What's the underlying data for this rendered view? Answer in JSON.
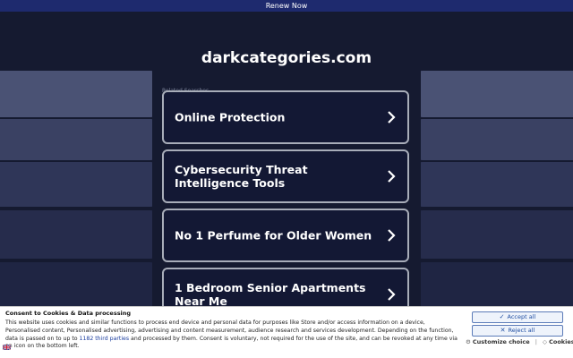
{
  "topbar": {
    "label": "Renew Now"
  },
  "site": {
    "domain": "darkcategories.com"
  },
  "related": {
    "label": "Related Searches"
  },
  "cards": [
    {
      "label": "Online Protection"
    },
    {
      "label": "Cybersecurity Threat Intelligence Tools"
    },
    {
      "label": "No 1 Perfume for Older Women"
    },
    {
      "label": "1 Bedroom Senior Apartments Near Me"
    }
  ],
  "cookie": {
    "title": "Consent to Cookies & Data processing",
    "text_before_link": "This website uses cookies and similar functions to process end device and personal data for purposes like Store and/or access information on a device, Personalised content, Personalised advertising, advertising and content measurement, audience research and services development. Depending on the function, data is passed on to up to ",
    "link_text": "1182 third parties",
    "text_after_link": " and processed by them. Consent is voluntary, not required for the use of the site, and can be revoked at any time via an icon on the bottom left.",
    "accept_all": "Accept all",
    "reject_all": "Reject all",
    "customize_choice": "Customize choice",
    "cookies": "Cookies",
    "separator": "|"
  },
  "colors": {
    "background": "#151a30",
    "topbar": "#1e2a6e",
    "card_border": "#a8adb9",
    "button_text": "#1f4ea2"
  }
}
